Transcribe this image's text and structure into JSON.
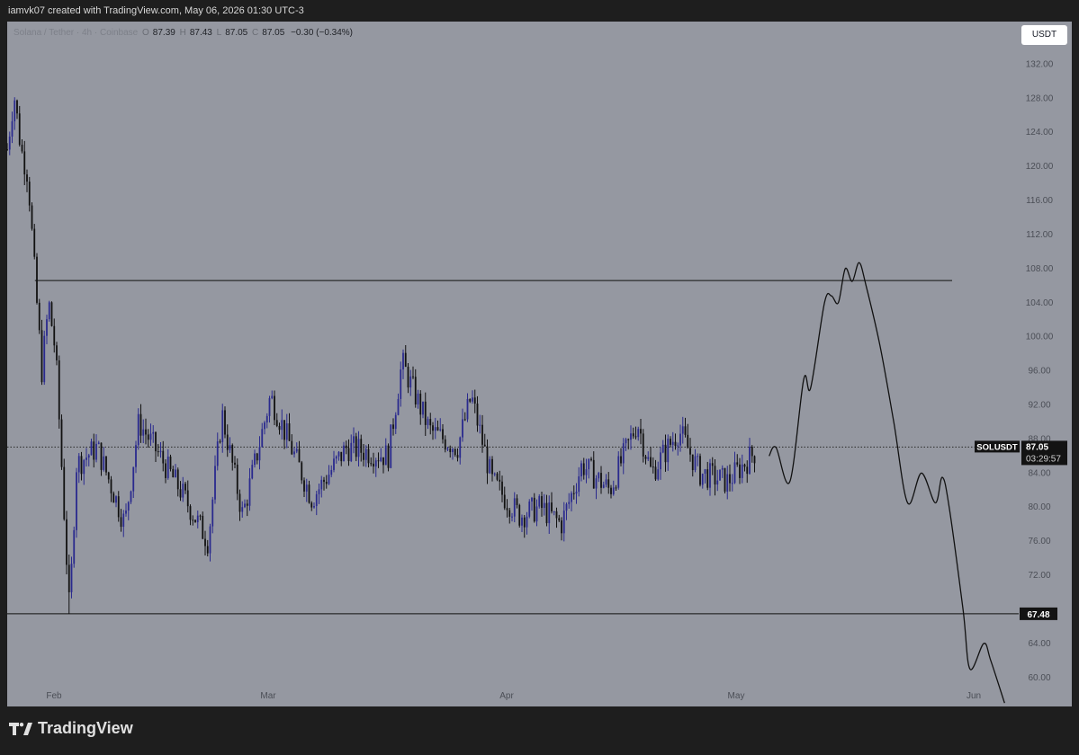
{
  "header": {
    "attribution": "iamvk07 created with TradingView.com, May 06, 2026 01:30 UTC-3"
  },
  "legend": {
    "symbol": "Solana / Tether · 4h · Coinbase",
    "open": "87.39",
    "high": "87.43",
    "low": "87.05",
    "close": "87.05",
    "change": "−0.30 (−0.34%)"
  },
  "currency_button": "USDT",
  "footer": {
    "brand": "TradingView"
  },
  "colors": {
    "pane_bg": "#9598a1",
    "candle_up": "#2a2a8e",
    "candle_down": "#111111",
    "line": "#111111",
    "page_bg": "#1e1e1e"
  },
  "chart_data": {
    "type": "candlestick",
    "y_axis": {
      "ticks": [
        "132.00",
        "128.00",
        "124.00",
        "120.00",
        "116.00",
        "112.00",
        "108.00",
        "104.00",
        "100.00",
        "96.00",
        "92.00",
        "88.00",
        "84.00",
        "80.00",
        "76.00",
        "72.00",
        "64.00",
        "60.00"
      ],
      "range": [
        56.6,
        137.0
      ],
      "side": "right"
    },
    "x_axis": {
      "ticks": [
        "Feb",
        "Mar",
        "Apr",
        "May",
        "Jun"
      ]
    },
    "price_badges": [
      {
        "label": "SOLUSDT",
        "value": "87.05",
        "countdown": "03:29:57"
      },
      {
        "value": "67.48"
      }
    ],
    "horizontal_levels": [
      106.6,
      67.48
    ],
    "current_price_line": 87.05,
    "price_path": [
      {
        "date": "2026-01-28",
        "price": 122
      },
      {
        "date": "2026-01-29",
        "price": 128.5
      },
      {
        "date": "2026-01-30",
        "price": 122
      },
      {
        "date": "2026-01-31",
        "price": 119
      },
      {
        "date": "2026-02-01",
        "price": 107
      },
      {
        "date": "2026-02-02",
        "price": 96
      },
      {
        "date": "2026-02-03",
        "price": 104
      },
      {
        "date": "2026-02-04",
        "price": 98
      },
      {
        "date": "2026-02-06",
        "price": 67.48
      },
      {
        "date": "2026-02-07",
        "price": 85
      },
      {
        "date": "2026-02-10",
        "price": 87
      },
      {
        "date": "2026-02-14",
        "price": 78
      },
      {
        "date": "2026-02-16",
        "price": 90
      },
      {
        "date": "2026-02-22",
        "price": 82
      },
      {
        "date": "2026-02-26",
        "price": 76
      },
      {
        "date": "2026-02-28",
        "price": 91
      },
      {
        "date": "2026-03-03",
        "price": 79
      },
      {
        "date": "2026-03-07",
        "price": 93
      },
      {
        "date": "2026-03-13",
        "price": 81
      },
      {
        "date": "2026-03-18",
        "price": 87
      },
      {
        "date": "2026-03-24",
        "price": 86
      },
      {
        "date": "2026-03-26",
        "price": 97
      },
      {
        "date": "2026-03-30",
        "price": 89
      },
      {
        "date": "2026-04-03",
        "price": 87
      },
      {
        "date": "2026-04-05",
        "price": 93
      },
      {
        "date": "2026-04-08",
        "price": 83
      },
      {
        "date": "2026-04-12",
        "price": 79
      },
      {
        "date": "2026-04-15",
        "price": 80
      },
      {
        "date": "2026-04-18",
        "price": 78
      },
      {
        "date": "2026-04-21",
        "price": 85
      },
      {
        "date": "2026-04-25",
        "price": 82
      },
      {
        "date": "2026-04-29",
        "price": 90
      },
      {
        "date": "2026-05-01",
        "price": 84
      },
      {
        "date": "2026-05-05",
        "price": 89
      },
      {
        "date": "2026-05-08",
        "price": 84
      },
      {
        "date": "2026-05-12",
        "price": 83
      },
      {
        "date": "2026-05-16",
        "price": 86.5
      }
    ],
    "projection": [
      {
        "date": "2026-05-18",
        "price": 86
      },
      {
        "date": "2026-05-19",
        "price": 87
      },
      {
        "date": "2026-05-21",
        "price": 83
      },
      {
        "date": "2026-05-23",
        "price": 95
      },
      {
        "date": "2026-05-24",
        "price": 94
      },
      {
        "date": "2026-05-26",
        "price": 104
      },
      {
        "date": "2026-05-27",
        "price": 104.8
      },
      {
        "date": "2026-05-28",
        "price": 104
      },
      {
        "date": "2026-05-29",
        "price": 108
      },
      {
        "date": "2026-05-30",
        "price": 106.5
      },
      {
        "date": "2026-05-31",
        "price": 108.7
      },
      {
        "date": "2026-06-01",
        "price": 106
      },
      {
        "date": "2026-06-03",
        "price": 99
      },
      {
        "date": "2026-06-05",
        "price": 90
      },
      {
        "date": "2026-06-07",
        "price": 80.5
      },
      {
        "date": "2026-06-09",
        "price": 84
      },
      {
        "date": "2026-06-11",
        "price": 80.5
      },
      {
        "date": "2026-06-12",
        "price": 83.5
      },
      {
        "date": "2026-06-13",
        "price": 80
      },
      {
        "date": "2026-06-15",
        "price": 68
      },
      {
        "date": "2026-06-16",
        "price": 61
      },
      {
        "date": "2026-06-18",
        "price": 64
      },
      {
        "date": "2026-06-19",
        "price": 62
      },
      {
        "date": "2026-06-21",
        "price": 57
      }
    ]
  }
}
